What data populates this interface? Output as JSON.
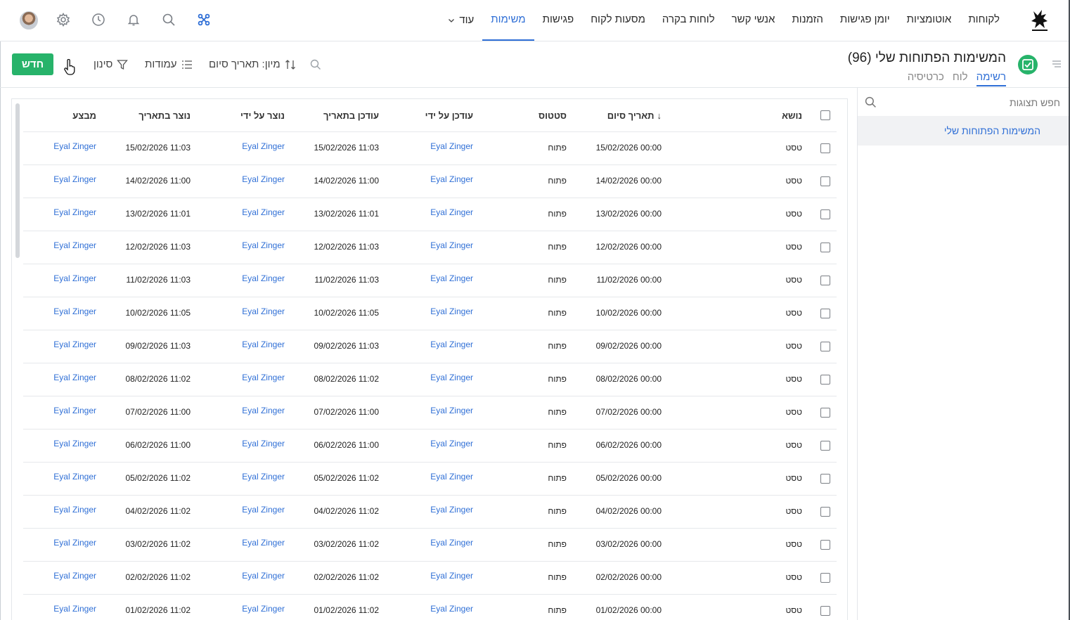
{
  "nav": {
    "items": [
      "לקוחות",
      "אוטומציות",
      "יומן פגישות",
      "הזמנות",
      "אנשי קשר",
      "לוחות בקרה",
      "מסעות לקוח",
      "פגישות",
      "משימות"
    ],
    "active": "משימות",
    "more_label": "עוד"
  },
  "header": {
    "title": "המשימות הפתוחות שלי (96)",
    "view_tabs": [
      "רשימה",
      "לוח",
      "כרטיסיה"
    ],
    "active_view": "רשימה"
  },
  "toolbar": {
    "new_label": "חדש",
    "filter_label": "סינון",
    "columns_label": "עמודות",
    "sort_label": "מיון: תאריך סיום"
  },
  "sidebar": {
    "search_placeholder": "חפש תצוגות",
    "items": [
      "המשימות הפתוחות שלי"
    ]
  },
  "table": {
    "columns": {
      "subject": "נושא",
      "due_date": "תאריך סיום",
      "status": "סטטוס",
      "updated_by": "עודכן על ידי",
      "updated_at": "עודכן בתאריך",
      "created_by": "נוצר על ידי",
      "created_at": "נוצר בתאריך",
      "executor": "מבצע"
    },
    "sort_indicator": "↓",
    "rows": [
      {
        "subject": "טסט",
        "due_date": "15/02/2026 00:00",
        "status": "פתוח",
        "updated_by": "Eyal Zinger",
        "updated_at": "15/02/2026 11:03",
        "created_by": "Eyal Zinger",
        "created_at": "15/02/2026 11:03",
        "executor": "Eyal Zinger"
      },
      {
        "subject": "טסט",
        "due_date": "14/02/2026 00:00",
        "status": "פתוח",
        "updated_by": "Eyal Zinger",
        "updated_at": "14/02/2026 11:00",
        "created_by": "Eyal Zinger",
        "created_at": "14/02/2026 11:00",
        "executor": "Eyal Zinger"
      },
      {
        "subject": "טסט",
        "due_date": "13/02/2026 00:00",
        "status": "פתוח",
        "updated_by": "Eyal Zinger",
        "updated_at": "13/02/2026 11:01",
        "created_by": "Eyal Zinger",
        "created_at": "13/02/2026 11:01",
        "executor": "Eyal Zinger"
      },
      {
        "subject": "טסט",
        "due_date": "12/02/2026 00:00",
        "status": "פתוח",
        "updated_by": "Eyal Zinger",
        "updated_at": "12/02/2026 11:03",
        "created_by": "Eyal Zinger",
        "created_at": "12/02/2026 11:03",
        "executor": "Eyal Zinger"
      },
      {
        "subject": "טסט",
        "due_date": "11/02/2026 00:00",
        "status": "פתוח",
        "updated_by": "Eyal Zinger",
        "updated_at": "11/02/2026 11:03",
        "created_by": "Eyal Zinger",
        "created_at": "11/02/2026 11:03",
        "executor": "Eyal Zinger"
      },
      {
        "subject": "טסט",
        "due_date": "10/02/2026 00:00",
        "status": "פתוח",
        "updated_by": "Eyal Zinger",
        "updated_at": "10/02/2026 11:05",
        "created_by": "Eyal Zinger",
        "created_at": "10/02/2026 11:05",
        "executor": "Eyal Zinger"
      },
      {
        "subject": "טסט",
        "due_date": "09/02/2026 00:00",
        "status": "פתוח",
        "updated_by": "Eyal Zinger",
        "updated_at": "09/02/2026 11:03",
        "created_by": "Eyal Zinger",
        "created_at": "09/02/2026 11:03",
        "executor": "Eyal Zinger"
      },
      {
        "subject": "טסט",
        "due_date": "08/02/2026 00:00",
        "status": "פתוח",
        "updated_by": "Eyal Zinger",
        "updated_at": "08/02/2026 11:02",
        "created_by": "Eyal Zinger",
        "created_at": "08/02/2026 11:02",
        "executor": "Eyal Zinger"
      },
      {
        "subject": "טסט",
        "due_date": "07/02/2026 00:00",
        "status": "פתוח",
        "updated_by": "Eyal Zinger",
        "updated_at": "07/02/2026 11:00",
        "created_by": "Eyal Zinger",
        "created_at": "07/02/2026 11:00",
        "executor": "Eyal Zinger"
      },
      {
        "subject": "טסט",
        "due_date": "06/02/2026 00:00",
        "status": "פתוח",
        "updated_by": "Eyal Zinger",
        "updated_at": "06/02/2026 11:00",
        "created_by": "Eyal Zinger",
        "created_at": "06/02/2026 11:00",
        "executor": "Eyal Zinger"
      },
      {
        "subject": "טסט",
        "due_date": "05/02/2026 00:00",
        "status": "פתוח",
        "updated_by": "Eyal Zinger",
        "updated_at": "05/02/2026 11:02",
        "created_by": "Eyal Zinger",
        "created_at": "05/02/2026 11:02",
        "executor": "Eyal Zinger"
      },
      {
        "subject": "טסט",
        "due_date": "04/02/2026 00:00",
        "status": "פתוח",
        "updated_by": "Eyal Zinger",
        "updated_at": "04/02/2026 11:02",
        "created_by": "Eyal Zinger",
        "created_at": "04/02/2026 11:02",
        "executor": "Eyal Zinger"
      },
      {
        "subject": "טסט",
        "due_date": "03/02/2026 00:00",
        "status": "פתוח",
        "updated_by": "Eyal Zinger",
        "updated_at": "03/02/2026 11:02",
        "created_by": "Eyal Zinger",
        "created_at": "03/02/2026 11:02",
        "executor": "Eyal Zinger"
      },
      {
        "subject": "טסט",
        "due_date": "02/02/2026 00:00",
        "status": "פתוח",
        "updated_by": "Eyal Zinger",
        "updated_at": "02/02/2026 11:02",
        "created_by": "Eyal Zinger",
        "created_at": "02/02/2026 11:02",
        "executor": "Eyal Zinger"
      },
      {
        "subject": "טסט",
        "due_date": "01/02/2026 00:00",
        "status": "פתוח",
        "updated_by": "Eyal Zinger",
        "updated_at": "01/02/2026 11:02",
        "created_by": "Eyal Zinger",
        "created_at": "01/02/2026 11:02",
        "executor": "Eyal Zinger"
      }
    ]
  },
  "icons": [
    "logo-icon",
    "apps-icon",
    "search-icon",
    "bell-icon",
    "clock-icon",
    "gear-icon",
    "avatar",
    "check-square-icon",
    "menu-lines-icon",
    "filter-icon",
    "columns-icon",
    "sort-icon",
    "cursor-icon",
    "chevron-down-icon"
  ],
  "colors": {
    "accent": "#2f6fd6",
    "success": "#27b36a",
    "border": "#e3e6ea"
  }
}
